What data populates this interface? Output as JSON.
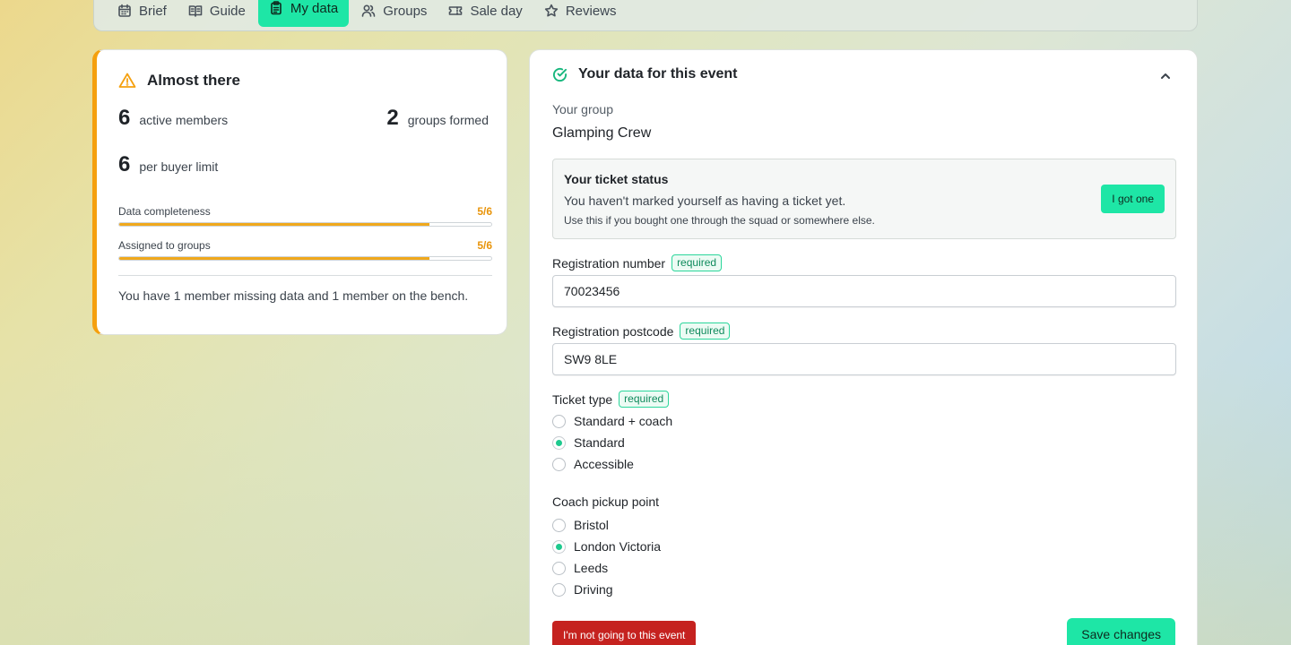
{
  "tabs": [
    {
      "label": "Brief",
      "icon": "calendar-icon"
    },
    {
      "label": "Guide",
      "icon": "book-icon"
    },
    {
      "label": "My data",
      "icon": "clipboard-icon",
      "active": true
    },
    {
      "label": "Groups",
      "icon": "users-icon"
    },
    {
      "label": "Sale day",
      "icon": "ticket-icon"
    },
    {
      "label": "Reviews",
      "icon": "star-icon"
    }
  ],
  "summary": {
    "title": "Almost there",
    "icon": "warning-icon",
    "accent": "#f5a00e",
    "active_members": {
      "num": "6",
      "label": "active members"
    },
    "groups_formed": {
      "num": "2",
      "label": "groups formed"
    },
    "buyer_limit": {
      "num": "6",
      "label": "per buyer limit"
    },
    "progress": [
      {
        "label": "Data completeness",
        "value": "5/6",
        "fraction": 0.8333
      },
      {
        "label": "Assigned to groups",
        "value": "5/6",
        "fraction": 0.8333
      }
    ],
    "footnote": "You have 1 member missing data and 1 member on the bench."
  },
  "detail": {
    "title": "Your data for this event",
    "icon": "check-circle-icon",
    "group_label": "Your group",
    "group_name": "Glamping Crew",
    "ticket_status": {
      "heading": "Your ticket status",
      "message": "You haven't marked yourself as having a ticket yet.",
      "hint": "Use this if you bought one through the squad or somewhere else.",
      "button": "I got one"
    },
    "required_badge": "required",
    "registration_number": {
      "label": "Registration number",
      "value": "70023456"
    },
    "registration_postcode": {
      "label": "Registration postcode",
      "value": "SW9 8LE"
    },
    "ticket_type": {
      "label": "Ticket type",
      "options": [
        "Standard + coach",
        "Standard",
        "Accessible"
      ],
      "selected": "Standard"
    },
    "coach_pickup": {
      "label": "Coach pickup point",
      "options": [
        "Bristol",
        "London Victoria",
        "Leeds",
        "Driving"
      ],
      "selected": "London Victoria"
    },
    "not_going_button": "I'm not going to this event",
    "save_button": "Save changes"
  },
  "colors": {
    "brand": "#1ee6a6",
    "warning": "#f5a00e",
    "danger": "#c5221f"
  }
}
